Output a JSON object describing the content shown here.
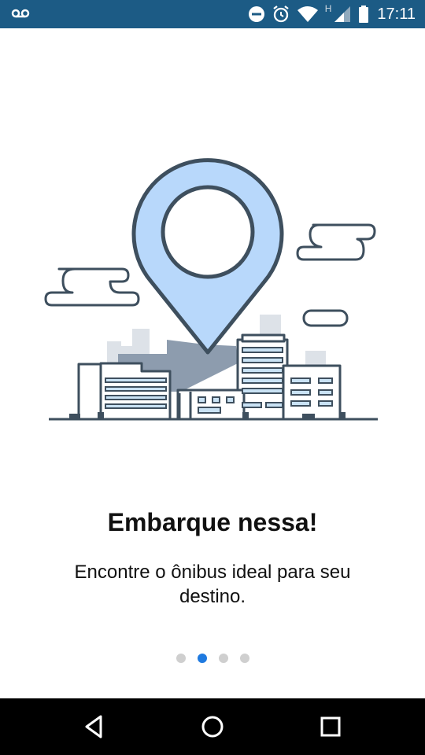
{
  "status_bar": {
    "time": "17:11",
    "network_label": "H",
    "icons": [
      "voicemail-icon",
      "do-not-disturb-icon",
      "alarm-icon",
      "wifi-icon",
      "cellular-signal-icon",
      "battery-icon"
    ]
  },
  "onboarding": {
    "title": "Embarque nessa!",
    "subtitle": "Encontre o ônibus ideal para seu destino.",
    "page_count": 4,
    "current_page": 2,
    "illustration": "map-pin-city-illustration"
  },
  "colors": {
    "status_bar": "#1c5b85",
    "pin_fill": "#b8d8fb",
    "outline": "#3e4f5e",
    "dot_active": "#1f7ae0",
    "dot_inactive": "#cfcfcf"
  },
  "nav_bar": {
    "icons": [
      "back-icon",
      "home-icon",
      "recents-icon"
    ]
  }
}
